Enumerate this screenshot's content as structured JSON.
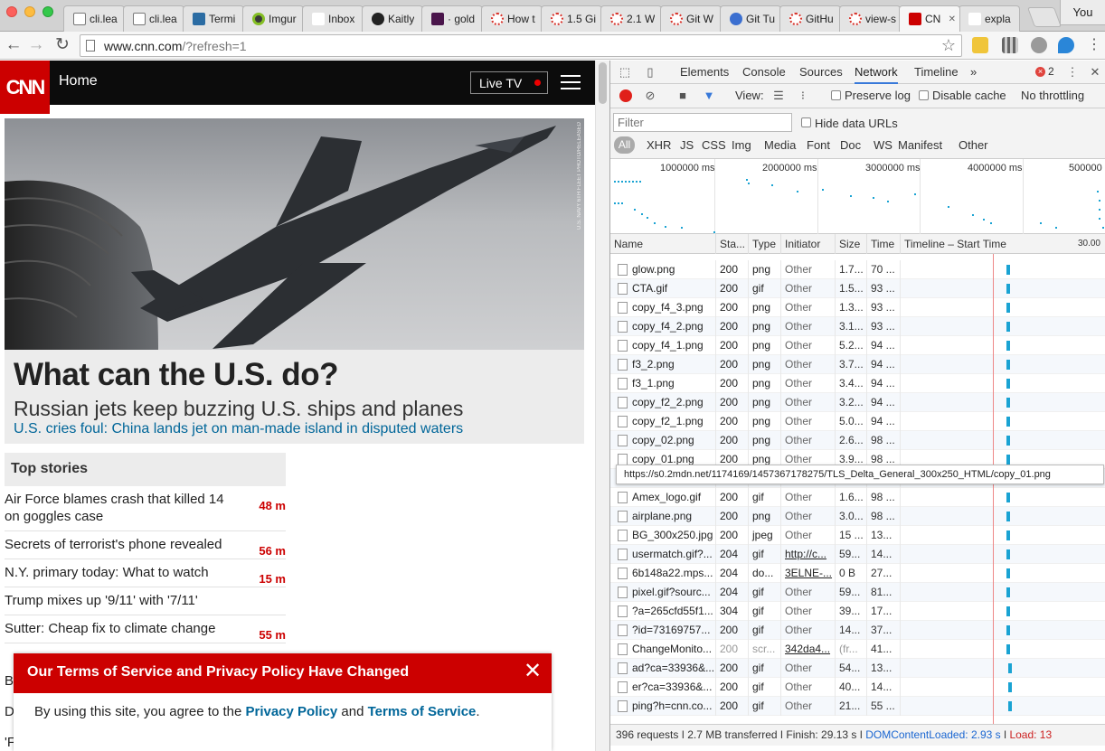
{
  "browser": {
    "tabs": [
      {
        "label": "cli.lea",
        "icon": "document-icon",
        "fav": "fav-doc"
      },
      {
        "label": "cli.lea",
        "icon": "document-icon",
        "fav": "fav-doc"
      },
      {
        "label": "Termi",
        "icon": "tr-icon",
        "fav": "fav-tr"
      },
      {
        "label": "Imgur",
        "icon": "imgur-icon",
        "fav": "fav-imgur"
      },
      {
        "label": "Inbox",
        "icon": "gmail-icon",
        "fav": "fav-gmail"
      },
      {
        "label": "Kaitly",
        "icon": "github-icon",
        "fav": "fav-gh"
      },
      {
        "label": "· gold",
        "icon": "hash-icon",
        "fav": "fav-hash"
      },
      {
        "label": "How t",
        "icon": "loading-icon",
        "fav": "fav-dotted"
      },
      {
        "label": "1.5 Gi",
        "icon": "loading-icon",
        "fav": "fav-dotted"
      },
      {
        "label": "2.1 W",
        "icon": "loading-icon",
        "fav": "fav-dotted"
      },
      {
        "label": "Git W",
        "icon": "loading-icon",
        "fav": "fav-dotted"
      },
      {
        "label": "Git Tu",
        "icon": "stack-icon",
        "fav": "fav-stack"
      },
      {
        "label": "GitHu",
        "icon": "loading-icon",
        "fav": "fav-dotted"
      },
      {
        "label": "view-s",
        "icon": "loading-icon",
        "fav": "fav-dotted"
      },
      {
        "label": "CN",
        "icon": "cnn-icon",
        "fav": "fav-cnn",
        "active": true
      },
      {
        "label": "expla",
        "icon": "feather-icon",
        "fav": "fav-feather"
      }
    ],
    "profile": "You",
    "url_host": "www.cnn.com",
    "url_rest": "/?refresh=1"
  },
  "cnn": {
    "logo": "CNN",
    "section": "Home",
    "live_tv": "Live TV",
    "hero_credit": "U.S. NAVY 6TH FLEET PHOTO/RELEASED",
    "headline": "What can the U.S. do?",
    "subheadline": "Russian jets keep buzzing U.S. ships and planes",
    "hero_link": "U.S. cries foul: China lands jet on man-made island in disputed waters",
    "top_stories_title": "Top stories",
    "stories": [
      {
        "title": "Air Force blames crash that killed 14 on goggles case",
        "age": "48 m"
      },
      {
        "title": "Secrets of terrorist's phone revealed",
        "age": "56 m"
      },
      {
        "title": "N.Y. primary today: What to watch",
        "age": "15 m"
      },
      {
        "title": "Trump mixes up '9/11' with '7/11'",
        "age": ""
      },
      {
        "title": "Sutter: Cheap fix to climate change",
        "age": "55 m"
      }
    ],
    "partial_letters": [
      "B",
      "D",
      "'F"
    ],
    "tos": {
      "title": "Our Terms of Service and Privacy Policy Have Changed",
      "close": "✕",
      "body_prefix": "By using this site, you agree to the",
      "privacy_link": "Privacy Policy",
      "and": "and",
      "terms_link": "Terms of Service",
      "suffix": "."
    }
  },
  "devtools": {
    "tabs": [
      "Elements",
      "Console",
      "Sources",
      "Network",
      "Timeline"
    ],
    "more": "»",
    "error_count": "2",
    "toolbar": {
      "view_label": "View:",
      "preserve_log": "Preserve log",
      "disable_cache": "Disable cache",
      "throttling": "No throttling"
    },
    "filter_placeholder": "Filter",
    "hide_data_urls": "Hide data URLs",
    "filter_types": [
      "All",
      "XHR",
      "JS",
      "CSS",
      "Img",
      "Media",
      "Font",
      "Doc",
      "WS",
      "Manifest",
      "Other"
    ],
    "overview_labels": [
      "1000000 ms",
      "2000000 ms",
      "3000000 ms",
      "4000000 ms",
      "500000"
    ],
    "columns": [
      "Name",
      "Sta...",
      "Type",
      "Initiator",
      "Size",
      "Time",
      "Timeline – Start Time"
    ],
    "timeline_scale": "30.00",
    "rows": [
      {
        "name": "glow.png",
        "status": "200",
        "type": "png",
        "initiator": "Other",
        "size": "1.7...",
        "time": "70 ..."
      },
      {
        "name": "CTA.gif",
        "status": "200",
        "type": "gif",
        "initiator": "Other",
        "size": "1.5...",
        "time": "93 ..."
      },
      {
        "name": "copy_f4_3.png",
        "status": "200",
        "type": "png",
        "initiator": "Other",
        "size": "1.3...",
        "time": "93 ..."
      },
      {
        "name": "copy_f4_2.png",
        "status": "200",
        "type": "png",
        "initiator": "Other",
        "size": "3.1...",
        "time": "93 ..."
      },
      {
        "name": "copy_f4_1.png",
        "status": "200",
        "type": "png",
        "initiator": "Other",
        "size": "5.2...",
        "time": "94 ..."
      },
      {
        "name": "f3_2.png",
        "status": "200",
        "type": "png",
        "initiator": "Other",
        "size": "3.7...",
        "time": "94 ..."
      },
      {
        "name": "f3_1.png",
        "status": "200",
        "type": "png",
        "initiator": "Other",
        "size": "3.4...",
        "time": "94 ..."
      },
      {
        "name": "copy_f2_2.png",
        "status": "200",
        "type": "png",
        "initiator": "Other",
        "size": "3.2...",
        "time": "94 ..."
      },
      {
        "name": "copy_f2_1.png",
        "status": "200",
        "type": "png",
        "initiator": "Other",
        "size": "5.0...",
        "time": "94 ..."
      },
      {
        "name": "copy_02.png",
        "status": "200",
        "type": "png",
        "initiator": "Other",
        "size": "2.6...",
        "time": "98 ..."
      },
      {
        "name": "copy_01.png",
        "status": "200",
        "type": "png",
        "initiator": "Other",
        "size": "3.9...",
        "time": "98 ..."
      },
      {
        "name": "",
        "status": "",
        "type": "",
        "initiator": "",
        "size": "",
        "time": ""
      },
      {
        "name": "Amex_logo.gif",
        "status": "200",
        "type": "gif",
        "initiator": "Other",
        "size": "1.6...",
        "time": "98 ..."
      },
      {
        "name": "airplane.png",
        "status": "200",
        "type": "png",
        "initiator": "Other",
        "size": "3.0...",
        "time": "98 ..."
      },
      {
        "name": "BG_300x250.jpg",
        "status": "200",
        "type": "jpeg",
        "initiator": "Other",
        "size": "15 ...",
        "time": "13..."
      },
      {
        "name": "usermatch.gif?...",
        "status": "204",
        "type": "gif",
        "initiator": "http://c...",
        "size": "59...",
        "time": "14...",
        "link": true
      },
      {
        "name": "6b148a22.mps...",
        "status": "204",
        "type": "do...",
        "initiator": "3ELNE-...",
        "size": "0 B",
        "time": "27...",
        "link": true
      },
      {
        "name": "pixel.gif?sourc...",
        "status": "204",
        "type": "gif",
        "initiator": "Other",
        "size": "59...",
        "time": "81..."
      },
      {
        "name": "?a=265cfd55f1...",
        "status": "304",
        "type": "gif",
        "initiator": "Other",
        "size": "39...",
        "time": "17..."
      },
      {
        "name": "?id=73169757...",
        "status": "200",
        "type": "gif",
        "initiator": "Other",
        "size": "14...",
        "time": "37..."
      },
      {
        "name": "ChangeMonito...",
        "status": "200",
        "type": "scr...",
        "initiator": "342da4...",
        "size": "(fr...",
        "time": "41...",
        "link": true,
        "muted": true
      },
      {
        "name": "ad?ca=33936&...",
        "status": "200",
        "type": "gif",
        "initiator": "Other",
        "size": "54...",
        "time": "13..."
      },
      {
        "name": "er?ca=33936&...",
        "status": "200",
        "type": "gif",
        "initiator": "Other",
        "size": "40...",
        "time": "14..."
      },
      {
        "name": "ping?h=cnn.co...",
        "status": "200",
        "type": "gif",
        "initiator": "Other",
        "size": "21...",
        "time": "55 ..."
      }
    ],
    "waterfall_offsets": [
      0.525,
      0.525,
      0.525,
      0.525,
      0.525,
      0.525,
      0.525,
      0.525,
      0.525,
      0.525,
      0.525,
      0.0,
      0.525,
      0.525,
      0.525,
      0.525,
      0.525,
      0.525,
      0.525,
      0.525,
      0.525,
      0.535,
      0.535,
      0.535
    ],
    "tooltip": "https://s0.2mdn.net/1174169/1457367178275/TLS_Delta_General_300x250_HTML/copy_01.png",
    "status": {
      "requests": "396 requests",
      "transferred": "2.7 MB transferred",
      "finish": "Finish: 29.13 s",
      "dcl": "DOMContentLoaded: 2.93 s",
      "load": "Load: 13"
    }
  }
}
